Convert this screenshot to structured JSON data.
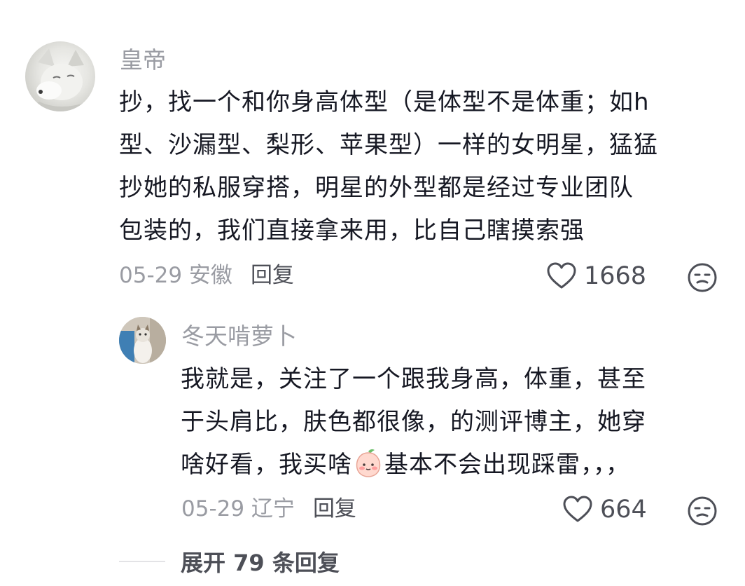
{
  "comment": {
    "username": "皇帝",
    "lines": [
      "抄，找一个和你身高体型（是体型不是体重；如h",
      "型、沙漏型、梨形、苹果型）一样的女明星，猛猛",
      "抄她的私服穿搭，明星的外型都是经过专业团队",
      "包装的，我们直接拿来用，比自己瞎摸索强"
    ],
    "date_location": "05-29 安徽",
    "reply_label": "回复",
    "likes": "1668"
  },
  "reply": {
    "username": "冬天啃萝卜",
    "line1": "我就是，关注了一个跟我身高，体重，甚至",
    "line2": "于头肩比，肤色都很像，的测评博主，她穿",
    "line3_before_emoji": "啥好看，我买啥",
    "line3_after_emoji": "基本不会出现踩雷，，，",
    "date_location": "05-29 辽宁",
    "reply_label": "回复",
    "likes": "664"
  },
  "expand_label": "展开 79 条回复",
  "icons": {
    "like": "heart-outline-icon",
    "dislike": "unamused-face-icon",
    "emoji": "peach-blush-emoji"
  },
  "colors": {
    "text": "#161823",
    "secondary": "#9a9ca3",
    "action": "#4d4f57"
  }
}
